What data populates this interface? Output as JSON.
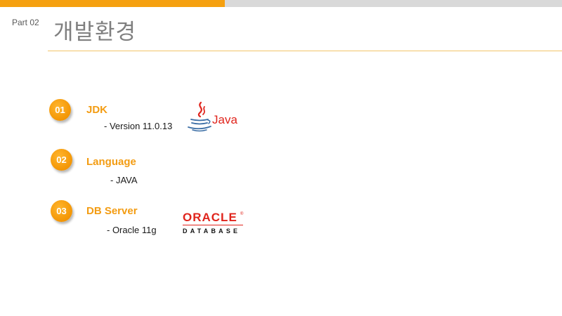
{
  "header": {
    "part_label": "Part 02",
    "title": "개발환경"
  },
  "colors": {
    "accent": "#f5a00f",
    "item_title": "#f39c12",
    "oracle_red": "#e0241c",
    "java_red": "#e0241c",
    "java_blue": "#3b6ea5"
  },
  "items": [
    {
      "number": "01",
      "title": "JDK",
      "detail": "- Version 11.0.13",
      "logo": "java-logo"
    },
    {
      "number": "02",
      "title": "Language",
      "detail": "- JAVA"
    },
    {
      "number": "03",
      "title": "DB Server",
      "detail": "- Oracle 11g",
      "logo": "oracle-database-logo"
    }
  ],
  "logos": {
    "java": {
      "word": "Java"
    },
    "oracle": {
      "word": "ORACLE",
      "registered": "®",
      "subtitle": "DATABASE"
    }
  }
}
